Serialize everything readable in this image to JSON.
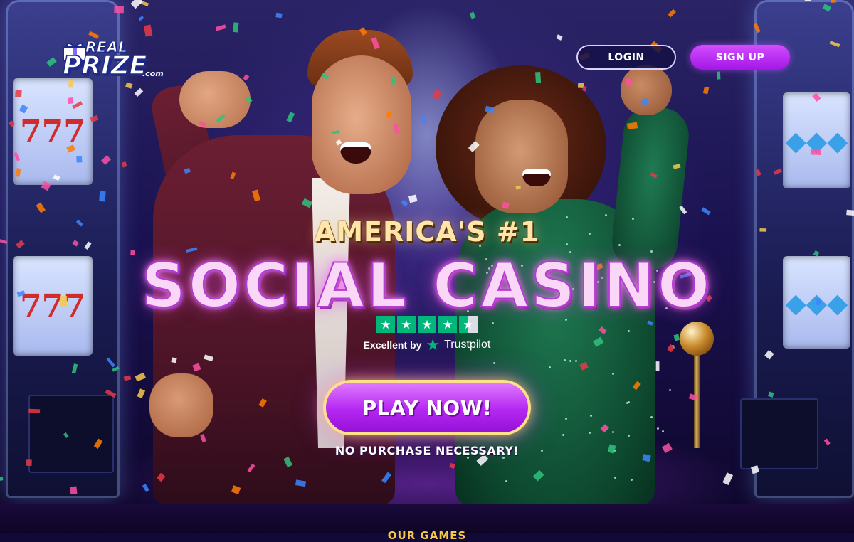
{
  "header": {
    "logo": {
      "top_text": "REAL",
      "main_text": "PRIZE",
      "suffix_text": ".com",
      "icon": "gift-icon"
    },
    "login_label": "LOGIN",
    "signup_label": "SIGN UP"
  },
  "hero": {
    "headline_line1": "AMERICA'S #1",
    "headline_line2": "SOCIAL CASINO",
    "rating": {
      "stars": 4.5,
      "max": 5,
      "label_prefix": "Excellent by",
      "brand": "Trustpilot"
    },
    "cta_label": "PLAY NOW!",
    "disclaimer": "NO PURCHASE NECESSARY!"
  },
  "slot_symbols": {
    "left": "777",
    "right": "◆◆◆"
  },
  "next_section_peek": "OUR GAMES",
  "colors": {
    "signup_bg": "#b52cf0",
    "play_button": "#b427f2",
    "play_border": "#ffe08a",
    "trustpilot_green": "#00b67a",
    "page_bg": "#120a36"
  }
}
